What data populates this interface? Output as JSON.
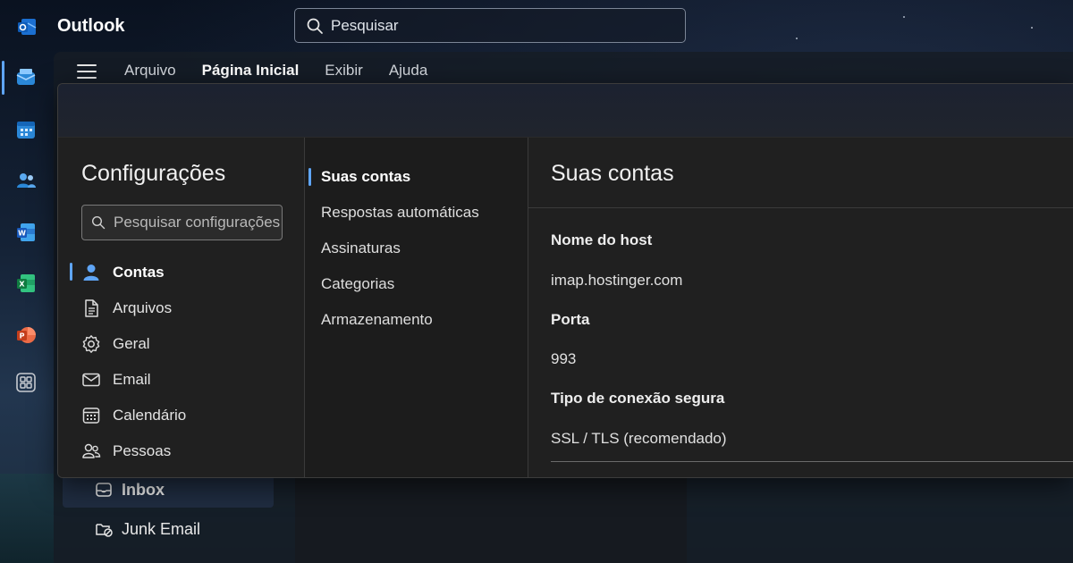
{
  "app": {
    "name": "Outlook"
  },
  "search": {
    "placeholder": "Pesquisar"
  },
  "menu": {
    "items": [
      "Arquivo",
      "Página Inicial",
      "Exibir",
      "Ajuda"
    ]
  },
  "folders": [
    {
      "label": "Inbox",
      "selected": true
    },
    {
      "label": "Junk Email",
      "selected": false
    }
  ],
  "settings": {
    "title": "Configurações",
    "search_placeholder": "Pesquisar configurações",
    "categories": [
      "Contas",
      "Arquivos",
      "Geral",
      "Email",
      "Calendário",
      "Pessoas"
    ],
    "active_category": "Contas",
    "subcategories": [
      "Suas contas",
      "Respostas automáticas",
      "Assinaturas",
      "Categorias",
      "Armazenamento"
    ],
    "active_subcategory": "Suas contas"
  },
  "panel": {
    "title": "Suas contas",
    "fields": [
      {
        "label": "Nome do host",
        "value": "imap.hostinger.com"
      },
      {
        "label": "Porta",
        "value": "993"
      },
      {
        "label": "Tipo de conexão segura",
        "value": "SSL / TLS (recomendado)"
      }
    ]
  },
  "colors": {
    "accent": "#5fa5f6",
    "modal_bg": "#232323"
  }
}
